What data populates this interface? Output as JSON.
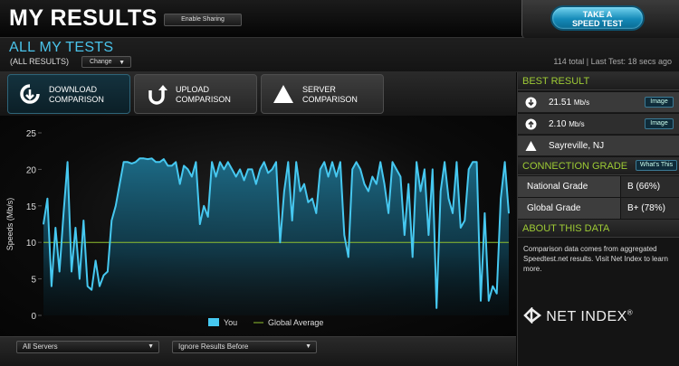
{
  "header": {
    "title": "MY RESULTS",
    "enable_sharing": "Enable Sharing",
    "take_test_line1": "TAKE A",
    "take_test_line2": "SPEED TEST"
  },
  "subheader": {
    "title": "ALL MY TESTS",
    "filter_label": "(ALL RESULTS)",
    "change_label": "Change",
    "stats": "114 total | Last Test: 18 secs ago"
  },
  "comparison": {
    "buttons": [
      {
        "line1": "DOWNLOAD",
        "line2": "COMPARISON",
        "icon": "download-refresh-icon",
        "active": true
      },
      {
        "line1": "UPLOAD",
        "line2": "COMPARISON",
        "icon": "upload-arrow-icon",
        "active": false
      },
      {
        "line1": "SERVER",
        "line2": "COMPARISON",
        "icon": "triangle-icon",
        "active": false
      }
    ]
  },
  "bottom": {
    "servers_select": "All Servers",
    "ignore_select": "Ignore Results Before"
  },
  "side": {
    "best_result_title": "BEST RESULT",
    "download_value": "21.51",
    "download_unit": "Mb/s",
    "upload_value": "2.10",
    "upload_unit": "Mb/s",
    "image_label": "Image",
    "server_location": "Sayreville, NJ",
    "connection_grade_title": "CONNECTION GRADE",
    "whats_this": "What's This",
    "national_label": "National Grade",
    "national_value": "B (66%)",
    "global_label": "Global Grade",
    "global_value": "B+ (78%)",
    "about_title": "ABOUT THIS DATA",
    "about_text": "Comparison data comes from aggregated Speedtest.net results. Visit Net Index to learn more.",
    "logo_text": "NET INDEX",
    "logo_mark": "®"
  },
  "colors": {
    "accent_blue": "#4ac3ea",
    "grade_green": "#9ecb35",
    "global_avg_line": "#8fbf2f"
  },
  "chart_data": {
    "type": "area",
    "ylabel": "Speeds (Mb/s)",
    "ylim": [
      0,
      25
    ],
    "yticks": [
      0,
      5,
      10,
      15,
      20,
      25
    ],
    "legend": [
      {
        "name": "You",
        "color": "#46c8f0"
      },
      {
        "name": "Global Average",
        "color": "#8fbf2f"
      }
    ],
    "global_average": 10,
    "series": [
      {
        "name": "You",
        "values": [
          12.5,
          16,
          4,
          12,
          6,
          14,
          21,
          6,
          12,
          5,
          13,
          4,
          3.5,
          7.5,
          4,
          5.5,
          6,
          13,
          15,
          18,
          21,
          21,
          20.8,
          21,
          21.5,
          21.5,
          21.4,
          21.5,
          21,
          21,
          21.4,
          20.5,
          20.5,
          21,
          18,
          20.5,
          20,
          19,
          21,
          12.5,
          15,
          13.5,
          21,
          19,
          21,
          20,
          21,
          20,
          19,
          20,
          18.5,
          20,
          20,
          18,
          20,
          21,
          19.5,
          20,
          21,
          10,
          17,
          21,
          13,
          21,
          17,
          18,
          15.5,
          16,
          14,
          20,
          21,
          19,
          21,
          19,
          21,
          11,
          8,
          20,
          21,
          20,
          18,
          17,
          19,
          18,
          21,
          18,
          14,
          21,
          20,
          19,
          11,
          18,
          8,
          21,
          17,
          20,
          11,
          20,
          1,
          17,
          21,
          16,
          14,
          21,
          12,
          13,
          20,
          21,
          21,
          2,
          14,
          2,
          4,
          3,
          16,
          21,
          14
        ]
      }
    ]
  }
}
